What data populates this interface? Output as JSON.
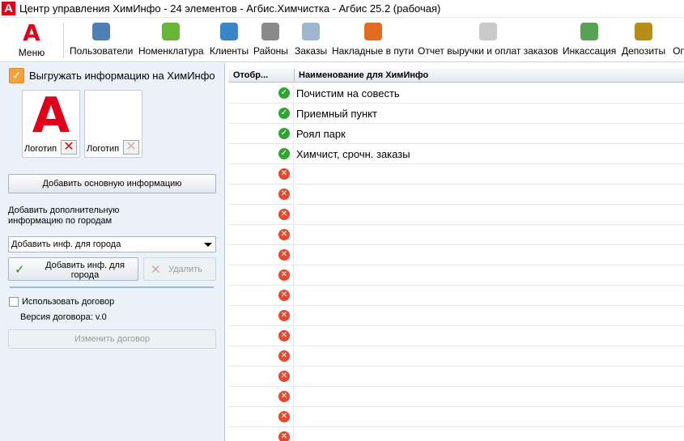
{
  "window": {
    "title": "Центр управления ХимИнфо - 24 элементов - Агбис.Химчистка - Агбис 25.2 (рабочая)",
    "app_icon_glyph": "A"
  },
  "toolbar": {
    "menu_label": "Меню",
    "menu_glyph": "A",
    "items": [
      {
        "label": "Пользователи",
        "icon": "users-icon",
        "color": "#4f7fb3"
      },
      {
        "label": "Номенклатура",
        "icon": "basket-icon",
        "color": "#6bb43a"
      },
      {
        "label": "Клиенты",
        "icon": "client-icon",
        "color": "#3b86c8"
      },
      {
        "label": "Районы",
        "icon": "buildings-icon",
        "color": "#8a8a8a"
      },
      {
        "label": "Заказы",
        "icon": "document-icon",
        "color": "#9fb6cf"
      },
      {
        "label": "Накладные в пути",
        "icon": "truck-icon",
        "color": "#e46b1f"
      },
      {
        "label": "Отчет выручки и оплат заказов",
        "icon": "report-icon",
        "color": "#c9c9c9"
      },
      {
        "label": "Инкассация",
        "icon": "money-icon",
        "color": "#5aa354"
      },
      {
        "label": "Депозиты",
        "icon": "deposit-icon",
        "color": "#b58d18"
      },
      {
        "label": "Оп",
        "icon": "more-icon",
        "color": "#ffffff"
      }
    ]
  },
  "left": {
    "export_label": "Выгружать информацию на ХимИнфо",
    "export_checked": true,
    "logos": [
      {
        "label": "Логотип",
        "glyph": "A",
        "remove": "✕"
      },
      {
        "label": "Логотип",
        "glyph": "",
        "remove": "✕"
      }
    ],
    "add_main_info": "Добавить основную информацию",
    "add_cities_text_1": "Добавить дополнительную",
    "add_cities_text_2": "информацию по городам",
    "city_select": "Добавить инф. для города",
    "add_city_btn_1": "Добавить инф. для",
    "add_city_btn_2": "города",
    "delete_btn": "Удалить",
    "use_contract_label": "Использовать договор",
    "contract_version": "Версия договора: v.0",
    "change_contract_btn": "Изменить договор"
  },
  "grid": {
    "columns": [
      "Отобр...",
      "Наименование для ХимИнфо"
    ],
    "rows": [
      {
        "status": "ok",
        "name": "Почистим на совесть"
      },
      {
        "status": "ok",
        "name": "Приемный пункт"
      },
      {
        "status": "ok",
        "name": "Роял парк"
      },
      {
        "status": "ok",
        "name": "Химчист, срочн. заказы"
      },
      {
        "status": "no",
        "name": ""
      },
      {
        "status": "no",
        "name": ""
      },
      {
        "status": "no",
        "name": ""
      },
      {
        "status": "no",
        "name": ""
      },
      {
        "status": "no",
        "name": ""
      },
      {
        "status": "no",
        "name": ""
      },
      {
        "status": "no",
        "name": ""
      },
      {
        "status": "no",
        "name": ""
      },
      {
        "status": "no",
        "name": ""
      },
      {
        "status": "no",
        "name": ""
      },
      {
        "status": "no",
        "name": ""
      },
      {
        "status": "no",
        "name": ""
      },
      {
        "status": "no",
        "name": ""
      },
      {
        "status": "no",
        "name": ""
      }
    ]
  }
}
